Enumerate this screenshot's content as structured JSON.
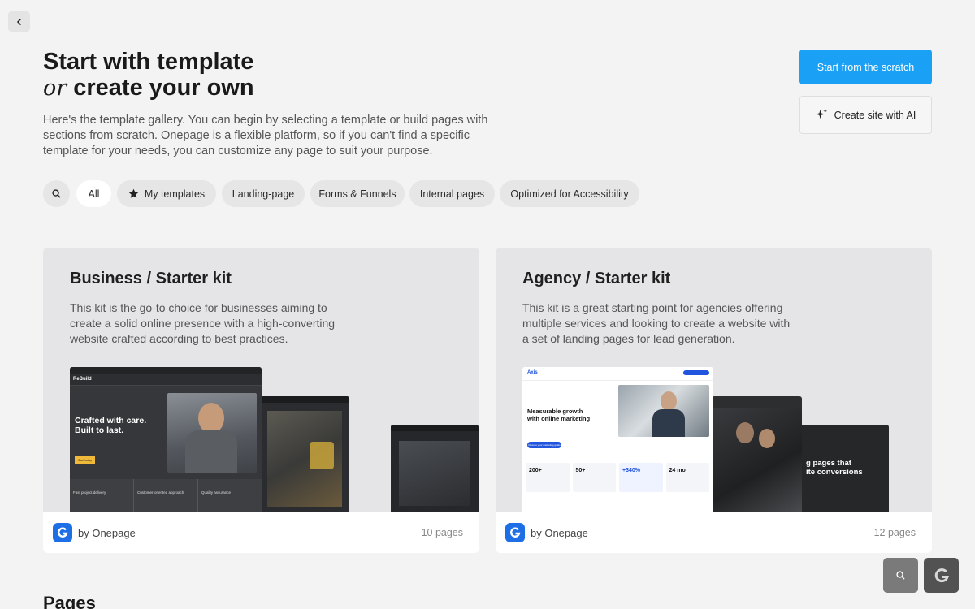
{
  "header": {
    "title_line1": "Start with template",
    "title_or": "or",
    "title_line2": "create your own",
    "intro": "Here's the template gallery. You can begin by selecting a template or build pages with sections from scratch. Onepage is a flexible platform, so if you can't find a specific template for your needs, you can customize any page to suit your purpose."
  },
  "actions": {
    "primary_label": "Start from the scratch",
    "ai_label": "Create site with AI"
  },
  "filters": {
    "search_icon": "search-icon",
    "chips": [
      "All",
      "My templates",
      "Landing-page",
      "Forms & Funnels",
      "Internal pages",
      "Optimized for Accessibility"
    ],
    "active": "All"
  },
  "cards": [
    {
      "title": "Business / Starter kit",
      "description": "This kit is the go-to choice for businesses aiming to create a solid online presence with a high-converting website crafted according to best practices.",
      "author": "by Onepage",
      "pages": "10 pages",
      "preview": {
        "brand": "ReBuild",
        "headline_1": "Crafted with care.",
        "headline_2": "Built to last.",
        "cta": "Start today",
        "feature_1": "Fast project delivery",
        "feature_2": "Customer-oriented approach",
        "feature_3": "Quality assurance"
      }
    },
    {
      "title": "Agency / Starter kit",
      "description": "This kit is a great starting point for agencies offering multiple services and looking to create a website with a set of landing pages for lead generation.",
      "author": "by Onepage",
      "pages": "12 pages",
      "preview": {
        "brand": "Axis",
        "headline_1": "Measurable growth",
        "headline_2": "with online marketing",
        "cta": "Discuss your marketing goals",
        "stats": [
          "200+",
          "50+",
          "+340%",
          "24 mo"
        ],
        "dark_text_1": "g pages that",
        "dark_text_2": "ite conversions"
      }
    }
  ],
  "section": {
    "pages_heading": "Pages"
  },
  "colors": {
    "accent": "#1aa0f5",
    "brand_logo": "#1e6fe6"
  }
}
